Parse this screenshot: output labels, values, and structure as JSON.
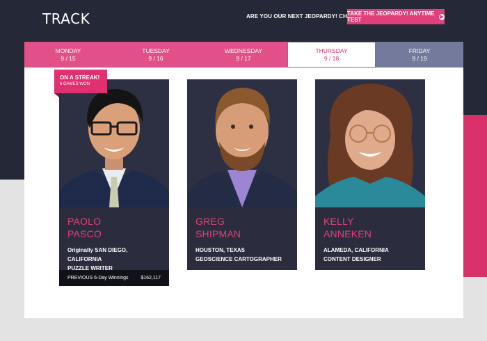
{
  "header": {
    "title": "TRACK",
    "promo_text": "ARE YOU OUR NEXT JEOPARDY! CHAMPION?",
    "cta_label": "TAKE THE JEOPARDY! ANYTIME TEST",
    "cta_icon": "arrow-circle-right-icon"
  },
  "tabs": [
    {
      "day": "MONDAY",
      "date": "9 / 15"
    },
    {
      "day": "TUESDAY",
      "date": "9 / 16"
    },
    {
      "day": "WEDNESDAY",
      "date": "9 / 17"
    },
    {
      "day": "THURSDAY",
      "date": "9 / 18"
    },
    {
      "day": "FRIDAY",
      "date": "9 / 19"
    }
  ],
  "streak_badge": {
    "title": "ON A STREAK!",
    "subtitle": "6 GAMES WON"
  },
  "contestants": [
    {
      "first": "PAOLO",
      "last": "PASCO",
      "location": "Originally SAN DIEGO, CALIFORNIA",
      "occupation": "PUZZLE WRITER",
      "winnings_label": "PREVIOUS 6-Day Winnings",
      "winnings_value": "$162,117"
    },
    {
      "first": "GREG",
      "last": "SHIPMAN",
      "location": "HOUSTON, TEXAS",
      "occupation": "GEOSCIENCE CARTOGRAPHER"
    },
    {
      "first": "KELLY",
      "last": "ANNEKEN",
      "location": "ALAMEDA, CALIFORNIA",
      "occupation": "CONTENT DESIGNER"
    }
  ],
  "colors": {
    "accent": "#e0407a",
    "tab_active_border": "#6f7595",
    "tab_friday": "#737a9c",
    "card_bg": "#2b2d3e"
  }
}
